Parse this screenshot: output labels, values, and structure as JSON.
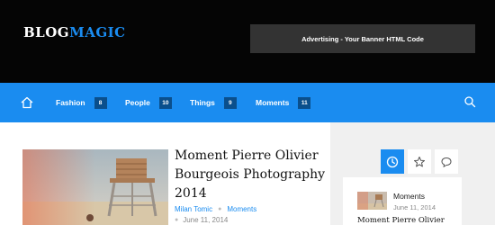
{
  "header": {
    "logo_part_a": "BLOG",
    "logo_part_b": "MAGIC",
    "banner_text": "Advertising - Your Banner HTML Code"
  },
  "nav": {
    "home_icon": "home-icon",
    "items": [
      {
        "label": "Fashion",
        "count": "8"
      },
      {
        "label": "People",
        "count": "10"
      },
      {
        "label": "Things",
        "count": "9"
      },
      {
        "label": "Moments",
        "count": "11"
      }
    ],
    "search_icon": "search-icon"
  },
  "post": {
    "title": "Moment Pierre Olivier Bourgeois Photography 2014",
    "author": "Milan Tomic",
    "category": "Moments",
    "date": "June 11, 2014"
  },
  "sidebar": {
    "tabs": [
      {
        "icon": "clock-icon",
        "active": true
      },
      {
        "icon": "star-icon",
        "active": false
      },
      {
        "icon": "comment-icon",
        "active": false
      }
    ],
    "item": {
      "category": "Moments",
      "date": "June 11, 2014",
      "title": "Moment Pierre Olivier"
    }
  },
  "colors": {
    "accent": "#1a8cf0",
    "header_bg": "#050505",
    "badge_bg": "#0a4f8c",
    "sidebar_bg": "#f0f0f0"
  }
}
